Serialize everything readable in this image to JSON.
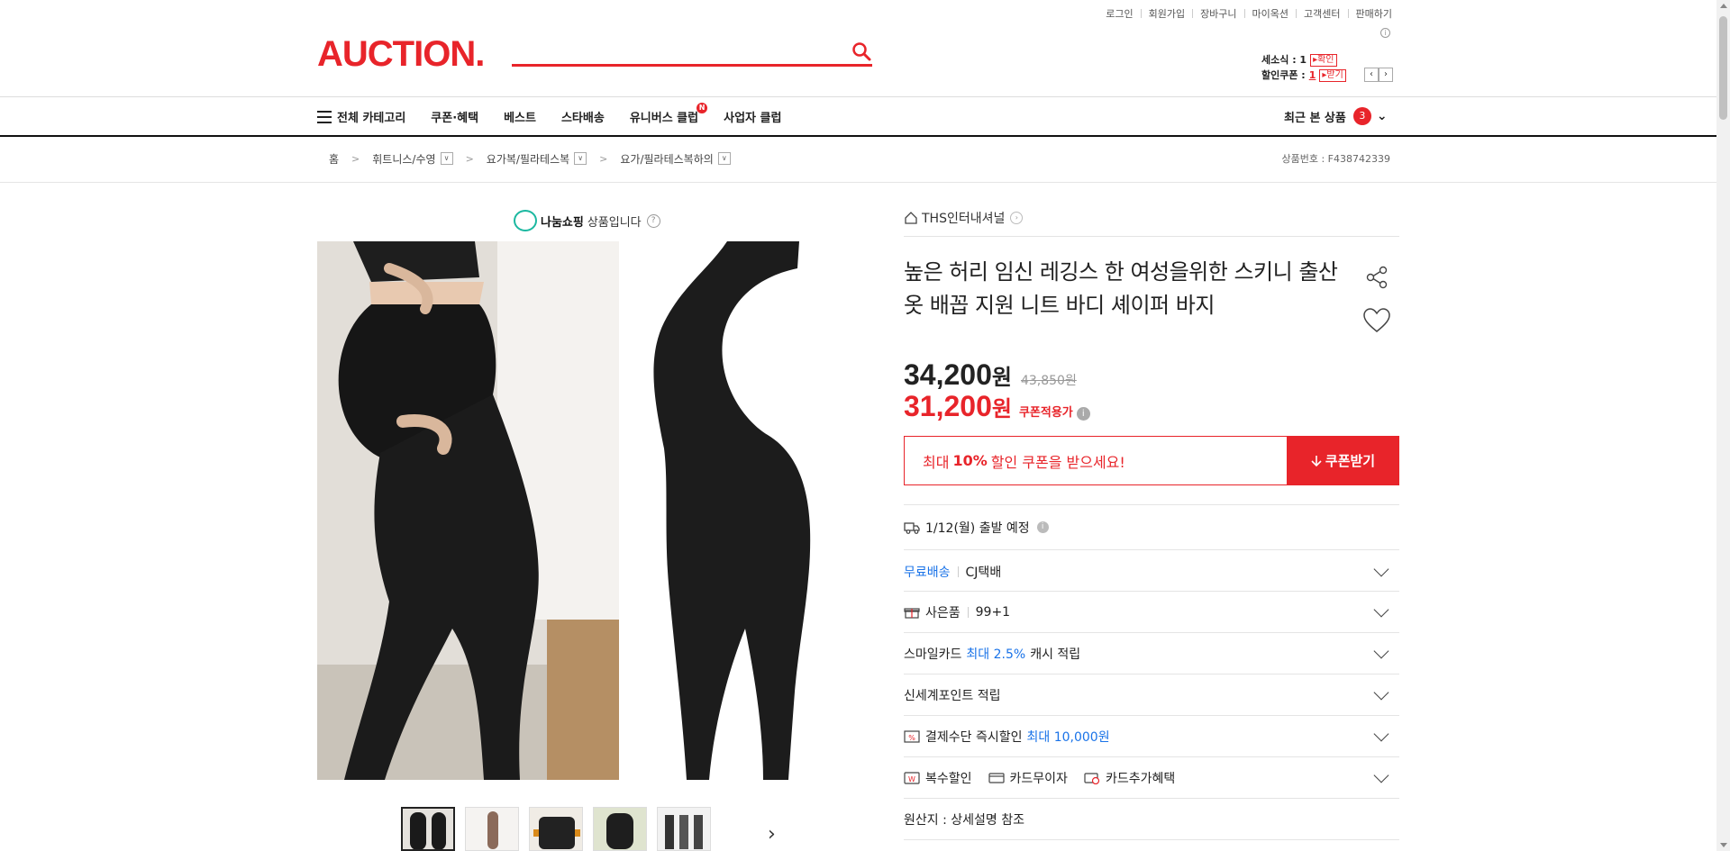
{
  "util_links": [
    "로그인",
    "회원가입",
    "장바구니",
    "마이옥션",
    "고객센터",
    "판매하기"
  ],
  "logo_text": "AUCTION.",
  "search": {
    "placeholder": ""
  },
  "coupons": {
    "smile_label": "세소식 : 1",
    "smile_btn": "확인",
    "discount_label": "할인쿠폰 :",
    "discount_count": "1",
    "discount_btn": "받기"
  },
  "nav": {
    "all_categories": "전체 카테고리",
    "items": [
      "쿠폰·혜택",
      "베스트",
      "스타배송",
      "유니버스 클럽",
      "사업자 클럽"
    ],
    "new_badge": "N",
    "recent_label": "최근 본 상품",
    "recent_count": "3"
  },
  "breadcrumb": [
    "홈",
    "휘트니스/수영",
    "요가복/필라테스복",
    "요가/필라테스복하의"
  ],
  "product_no": "상품번호 : F438742339",
  "nanum": {
    "brand": "나눔쇼핑",
    "text": "상품입니다"
  },
  "seller": "THS인터내셔널",
  "title": "높은 허리 임신 레깅스 한 여성을위한 스키니 출산 옷 배꼽 지원 니트 바디 셰이퍼 바지",
  "price": {
    "sale": "34,200",
    "won": "원",
    "original": "43,850원",
    "coupon_price": "31,200",
    "coupon_label": "쿠폰적용가"
  },
  "coupon_banner": {
    "pre": "최대",
    "pct": "10%",
    "post": "할인 쿠폰을 받으세요!",
    "button": "쿠폰받기"
  },
  "shipping_date": "1/12(월) 출발 예정",
  "rows": {
    "free_ship": "무료배송",
    "courier": "CJ택배",
    "gift_label": "사은품",
    "gift_value": "99+1",
    "smile_card_pre": "스마일카드",
    "smile_card_blue": "최대 2.5%",
    "smile_card_post": "캐시 적립",
    "shinsegae": "신세계포인트 적립",
    "pay_pre": "결제수단 즉시할인",
    "pay_blue": "최대 10,000원",
    "multi": "복수할인",
    "card_free": "카드무이자",
    "card_extra": "카드추가혜택",
    "origin": "원산지 : 상세설명 참조"
  },
  "colors": {
    "brand_red": "#e8242a",
    "link_blue": "#1a73e8"
  }
}
